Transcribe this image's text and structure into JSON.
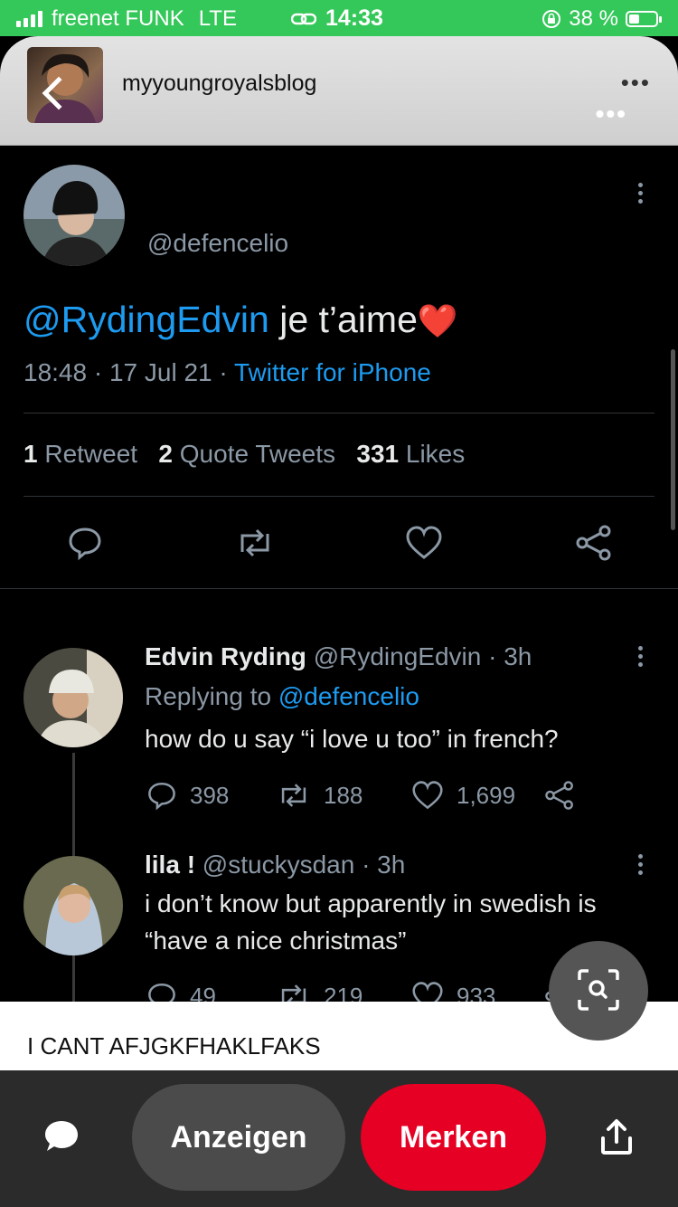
{
  "status_bar": {
    "carrier": "freenet FUNK",
    "network": "LTE",
    "time": "14:33",
    "battery": "38 %",
    "battery_level": 0.38
  },
  "header": {
    "blog_name": "myyoungroyalsblog",
    "back_icon": "chevron-left-icon",
    "more_icon": "ellipsis-icon"
  },
  "tweet": {
    "handle": "@defencelio",
    "mention": "@RydingEdvin",
    "text": " je t’aime",
    "emoji": "❤️",
    "time_date": "18:48 · 17 Jul 21 · ",
    "source": "Twitter for iPhone",
    "retweets_count": "1",
    "retweets_label": "Retweet",
    "quotes_count": "2",
    "quotes_label": "Quote Tweets",
    "likes_count": "331",
    "likes_label": "Likes"
  },
  "replies": [
    {
      "name": "Edvin Ryding",
      "handle": "@RydingEdvin · 3h",
      "replying_to_label": "Replying to ",
      "replying_to": "@defencelio",
      "text": "how do u say “i love u too” in french?",
      "replies": "398",
      "retweets": "188",
      "likes": "1,699"
    },
    {
      "name": "lila !",
      "handle": "@stuckysdan · 3h",
      "text_line1": "i don’t know but apparently in swedish is",
      "text_line2": "“have a nice christmas”",
      "replies": "49",
      "retweets": "219",
      "likes": "933"
    }
  ],
  "caption": "I CANT AFJGKFHAKLFAKS",
  "bottom_bar": {
    "show_label": "Anzeigen",
    "save_label": "Merken"
  },
  "colors": {
    "status_green": "#34c759",
    "link_blue": "#1d9bf0",
    "save_red": "#e60023"
  }
}
